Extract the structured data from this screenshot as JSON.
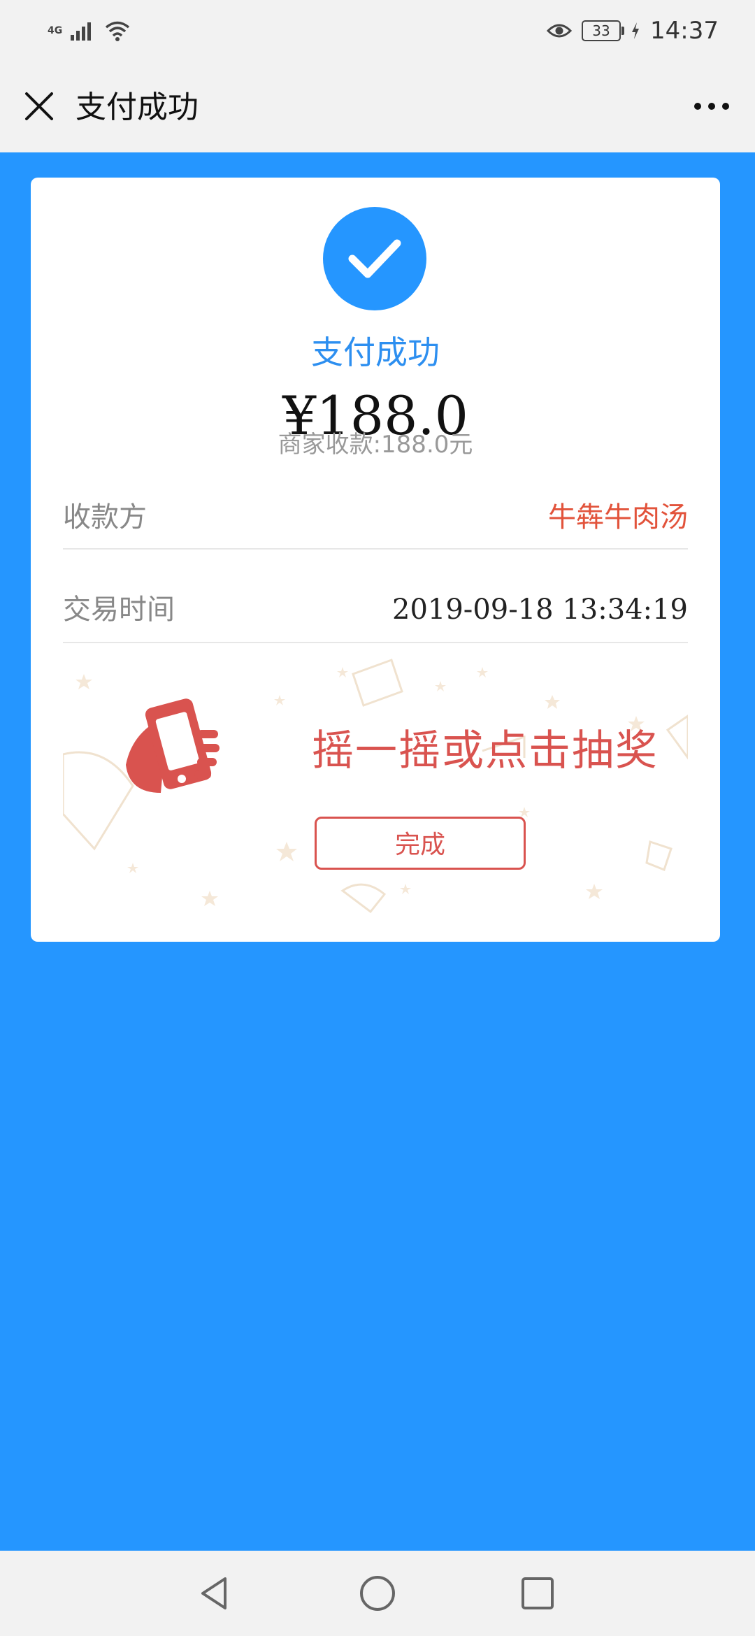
{
  "status_bar": {
    "network_label": "4G",
    "battery_level": "33",
    "time": "14:37"
  },
  "header": {
    "title": "支付成功"
  },
  "receipt": {
    "status_text": "支付成功",
    "amount": "¥188.0",
    "merchant_received": "商家收款:188.0元",
    "payee_label": "收款方",
    "payee_value": "牛犇牛肉汤",
    "time_label": "交易时间",
    "time_value": "2019-09-18 13:34:19"
  },
  "lottery": {
    "text": "摇一摇或点击抽奖",
    "done_button": "完成"
  },
  "colors": {
    "background_blue": "#2596ff",
    "accent_red": "#d9534f",
    "payee_red": "#e2533b"
  }
}
